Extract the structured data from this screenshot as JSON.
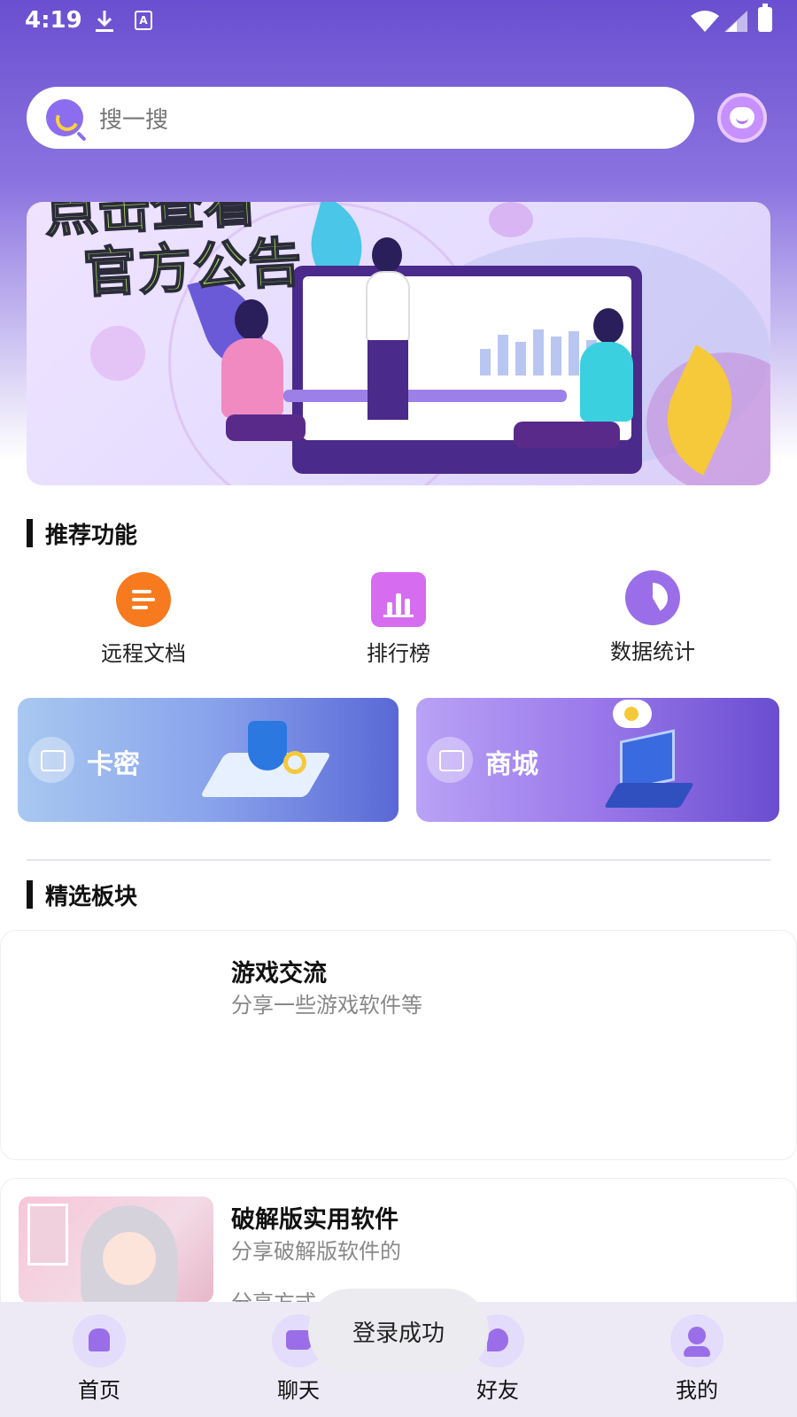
{
  "status_bar": {
    "time": "4:19"
  },
  "search": {
    "placeholder": "搜一搜"
  },
  "banner": {
    "title_top": "点击查看",
    "title": "官方公告"
  },
  "recommended": {
    "title": "推荐功能",
    "items": [
      {
        "label": "远程文档",
        "icon": "document-icon",
        "color": "#f77a1e"
      },
      {
        "label": "排行榜",
        "icon": "bar-chart-icon",
        "color": "#d66cf0"
      },
      {
        "label": "数据统计",
        "icon": "pie-chart-icon",
        "color": "#9a6ee8"
      }
    ]
  },
  "promo_cards": [
    {
      "label": "卡密",
      "icon": "card-icon"
    },
    {
      "label": "商城",
      "icon": "shopping-bag-icon"
    }
  ],
  "featured": {
    "title": "精选板块",
    "boards": [
      {
        "title": "游戏交流",
        "desc": "分享一些游戏软件等"
      },
      {
        "title": "破解版实用软件",
        "desc": "分享破解版软件的",
        "extra": "分享方式"
      }
    ]
  },
  "bottom_nav": [
    {
      "label": "首页",
      "icon": "home-icon"
    },
    {
      "label": "聊天",
      "icon": "chat-icon"
    },
    {
      "label": "好友",
      "icon": "friends-icon"
    },
    {
      "label": "我的",
      "icon": "profile-icon"
    }
  ],
  "toast": {
    "text": "登录成功"
  },
  "colors": {
    "accent": "#6a4fd0",
    "accent_light": "#9a6ee8"
  }
}
